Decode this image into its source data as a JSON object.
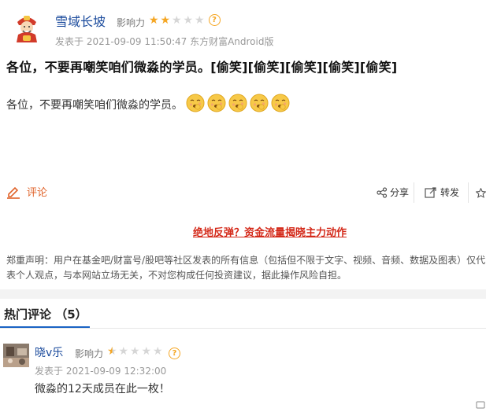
{
  "post": {
    "author": "雪域长坡",
    "influence_label": "影响力",
    "influence_stars": 2,
    "meta": "发表于 2021-09-09 11:50:47 东方财富Android版",
    "title": "各位，不要再嘲笑咱们微淼的学员。[偷笑][偷笑][偷笑][偷笑][偷笑]",
    "body": "各位，不要再嘲笑咱们微淼的学员。",
    "emoji_icon": "smirk-emoji",
    "emoji_count": 5
  },
  "actions": {
    "comment_label": "评论",
    "share_label": "分享",
    "repost_label": "转发"
  },
  "promo": {
    "text": "绝地反弹？资金流量揭晓主力动作"
  },
  "disclaimer": {
    "text": "郑重声明：用户在基金吧/财富号/股吧等社区发表的所有信息（包括但不限于文字、视频、音频、数据及图表）仅代表个人观点，与本网站立场无关，不对您构成任何投资建议，据此操作风险自担。"
  },
  "hot_comments": {
    "title": "热门评论 （5）",
    "items": [
      {
        "name": "晓v乐",
        "influence_label": "影响力",
        "influence_stars": 0.5,
        "meta": "发表于 2021-09-09 12:32:00",
        "text": "微淼的12天成员在此一枚！"
      }
    ]
  },
  "colors": {
    "accent": "#e0632a",
    "link": "#1a4a9c",
    "star": "#f5a623",
    "promo": "#d42a1a",
    "tab": "#1a63c4"
  }
}
